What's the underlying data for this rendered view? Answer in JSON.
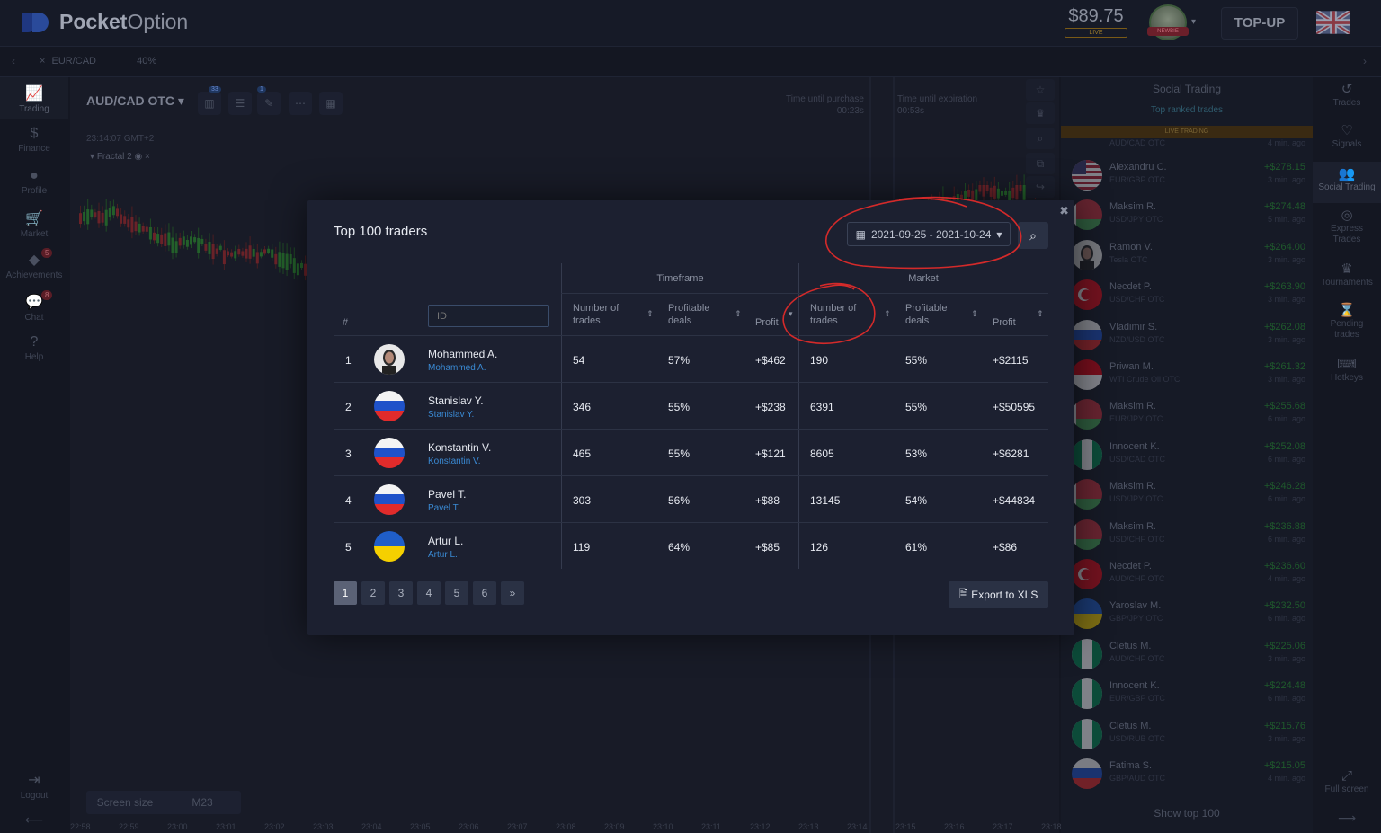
{
  "brand": {
    "name_bold": "Pocket",
    "name_light": "Option"
  },
  "header": {
    "balance": "$89.75",
    "account_mode": "LIVE",
    "avatar_badge": "NEWBIE",
    "topup_label": "TOP-UP"
  },
  "tabs": [
    {
      "pair": "EUR/CAD",
      "payout": "40%"
    }
  ],
  "left_nav": [
    {
      "label": "Trading",
      "icon": "chart-icon"
    },
    {
      "label": "Finance",
      "icon": "dollar-icon"
    },
    {
      "label": "Profile",
      "icon": "user-icon"
    },
    {
      "label": "Market",
      "icon": "cart-icon"
    },
    {
      "label": "Achievements",
      "icon": "diamond-icon",
      "badge": "5"
    },
    {
      "label": "Chat",
      "icon": "chat-icon",
      "badge": "8"
    },
    {
      "label": "Help",
      "icon": "help-icon"
    },
    {
      "label": "Logout",
      "icon": "logout-icon"
    }
  ],
  "chart": {
    "pair": "AUD/CAD OTC",
    "time": "23:14:07 GMT+2",
    "indicator": "Fractal 2",
    "tool_badges": [
      "33",
      "1"
    ],
    "purchase_label": "Time until purchase",
    "purchase_value": "00:23s",
    "expiration_label": "Time until expiration",
    "expiration_value": "00:53s",
    "screen_size_label": "Screen size",
    "timeframe": "M23",
    "axis_times": [
      "22:58",
      "22:59",
      "23:00",
      "23:01",
      "23:02",
      "23:03",
      "23:04",
      "23:05",
      "23:06",
      "23:07",
      "23:08",
      "23:09",
      "23:10",
      "23:11",
      "23:12",
      "23:13",
      "23:14",
      "23:15",
      "23:16",
      "23:17",
      "23:18"
    ]
  },
  "social": {
    "title": "Social Trading",
    "subtitle": "Top ranked trades",
    "live_label": "LIVE TRADING",
    "partial_pair": "AUD/CAD OTC",
    "partial_time": "4 min. ago",
    "show_top": "Show top 100",
    "trades": [
      {
        "name": "Alexandru C.",
        "pair": "EUR/GBP OTC",
        "profit": "+$278.15",
        "time": "3 min. ago",
        "flag": "us"
      },
      {
        "name": "Maksim R.",
        "pair": "USD/JPY OTC",
        "profit": "+$274.48",
        "time": "5 min. ago",
        "flag": "by"
      },
      {
        "name": "Ramon V.",
        "pair": "Tesla OTC",
        "profit": "+$264.00",
        "time": "3 min. ago",
        "flag": "photo"
      },
      {
        "name": "Necdet P.",
        "pair": "USD/CHF OTC",
        "profit": "+$263.90",
        "time": "3 min. ago",
        "flag": "tr"
      },
      {
        "name": "Vladimir S.",
        "pair": "NZD/USD OTC",
        "profit": "+$262.08",
        "time": "3 min. ago",
        "flag": "ru"
      },
      {
        "name": "Priwan M.",
        "pair": "WTI Crude Oil OTC",
        "profit": "+$261.32",
        "time": "3 min. ago",
        "flag": "id"
      },
      {
        "name": "Maksim R.",
        "pair": "EUR/JPY OTC",
        "profit": "+$255.68",
        "time": "6 min. ago",
        "flag": "by"
      },
      {
        "name": "Innocent K.",
        "pair": "USD/CAD OTC",
        "profit": "+$252.08",
        "time": "6 min. ago",
        "flag": "ng"
      },
      {
        "name": "Maksim R.",
        "pair": "USD/JPY OTC",
        "profit": "+$246.28",
        "time": "6 min. ago",
        "flag": "by"
      },
      {
        "name": "Maksim R.",
        "pair": "USD/CHF OTC",
        "profit": "+$236.88",
        "time": "6 min. ago",
        "flag": "by"
      },
      {
        "name": "Necdet P.",
        "pair": "AUD/CHF OTC",
        "profit": "+$236.60",
        "time": "4 min. ago",
        "flag": "tr"
      },
      {
        "name": "Yaroslav M.",
        "pair": "GBP/JPY OTC",
        "profit": "+$232.50",
        "time": "6 min. ago",
        "flag": "ua"
      },
      {
        "name": "Cletus M.",
        "pair": "AUD/CHF OTC",
        "profit": "+$225.06",
        "time": "3 min. ago",
        "flag": "ng"
      },
      {
        "name": "Innocent K.",
        "pair": "EUR/GBP OTC",
        "profit": "+$224.48",
        "time": "6 min. ago",
        "flag": "ng"
      },
      {
        "name": "Cletus M.",
        "pair": "USD/RUB OTC",
        "profit": "+$215.76",
        "time": "3 min. ago",
        "flag": "ng"
      },
      {
        "name": "Fatima S.",
        "pair": "GBP/AUD OTC",
        "profit": "+$215.05",
        "time": "4 min. ago",
        "flag": "ru"
      }
    ]
  },
  "right_nav": [
    {
      "label": "Trades",
      "icon": "history-icon"
    },
    {
      "label": "Signals",
      "icon": "signal-icon"
    },
    {
      "label": "Social Trading",
      "icon": "people-icon"
    },
    {
      "label": "Express Trades",
      "icon": "target-icon"
    },
    {
      "label": "Tournaments",
      "icon": "trophy-icon"
    },
    {
      "label": "Pending trades",
      "icon": "hourglass-icon"
    },
    {
      "label": "Hotkeys",
      "icon": "keyboard-icon"
    },
    {
      "label": "Full screen",
      "icon": "fullscreen-icon"
    }
  ],
  "modal": {
    "title": "Top 100 traders",
    "date_range": "2021-09-25 - 2021-10-24",
    "group_timeframe": "Timeframe",
    "group_market": "Market",
    "col_rank": "#",
    "id_placeholder": "ID",
    "col_trades": "Number of trades",
    "col_profitable": "Profitable deals",
    "col_profit": "Profit",
    "export_label": "Export to XLS",
    "pages": [
      "1",
      "2",
      "3",
      "4",
      "5",
      "6",
      "»"
    ],
    "rows": [
      {
        "rank": "1",
        "name": "Mohammed A.",
        "link": "Mohammed A.",
        "tf_trades": "54",
        "tf_deals": "57%",
        "tf_profit": "+$462",
        "mk_trades": "190",
        "mk_deals": "55%",
        "mk_profit": "+$2115",
        "flag": "photo"
      },
      {
        "rank": "2",
        "name": "Stanislav Y.",
        "link": "Stanislav Y.",
        "tf_trades": "346",
        "tf_deals": "55%",
        "tf_profit": "+$238",
        "mk_trades": "6391",
        "mk_deals": "55%",
        "mk_profit": "+$50595",
        "flag": "ru"
      },
      {
        "rank": "3",
        "name": "Konstantin V.",
        "link": "Konstantin V.",
        "tf_trades": "465",
        "tf_deals": "55%",
        "tf_profit": "+$121",
        "mk_trades": "8605",
        "mk_deals": "53%",
        "mk_profit": "+$6281",
        "flag": "ru"
      },
      {
        "rank": "4",
        "name": "Pavel T.",
        "link": "Pavel T.",
        "tf_trades": "303",
        "tf_deals": "56%",
        "tf_profit": "+$88",
        "mk_trades": "13145",
        "mk_deals": "54%",
        "mk_profit": "+$44834",
        "flag": "ru"
      },
      {
        "rank": "5",
        "name": "Artur L.",
        "link": "Artur L.",
        "tf_trades": "119",
        "tf_deals": "64%",
        "tf_profit": "+$85",
        "mk_trades": "126",
        "mk_deals": "61%",
        "mk_profit": "+$86",
        "flag": "ua"
      }
    ]
  },
  "colors": {
    "accent_link": "#3a8ad4",
    "annotation": "#d42a2a",
    "background": "#141722",
    "modal": "#1c2030"
  }
}
